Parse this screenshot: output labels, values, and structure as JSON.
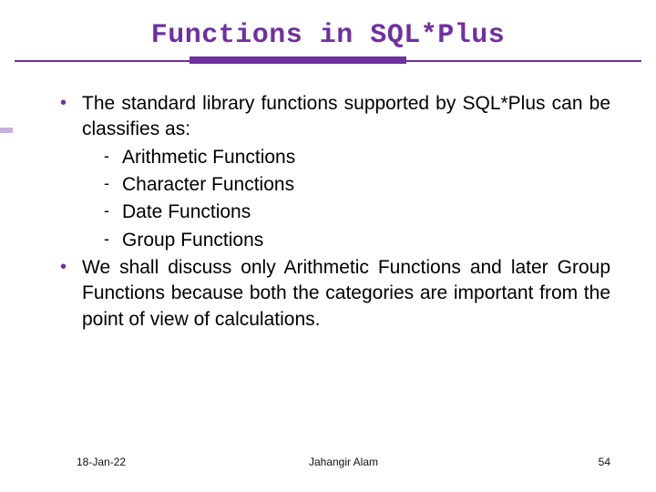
{
  "title": "Functions in SQL*Plus",
  "bullets": {
    "b1": "The standard library functions supported by SQL*Plus can be classifies as:",
    "sub": {
      "s1": "Arithmetic Functions",
      "s2": "Character Functions",
      "s3": "Date Functions",
      "s4": "Group Functions"
    },
    "b2": "We shall discuss only Arithmetic Functions and later Group Functions because both the categories are important from the point of view of calculations."
  },
  "footer": {
    "date": "18-Jan-22",
    "author": "Jahangir Alam",
    "page": "54"
  },
  "colors": {
    "accent": "#7030a0"
  }
}
